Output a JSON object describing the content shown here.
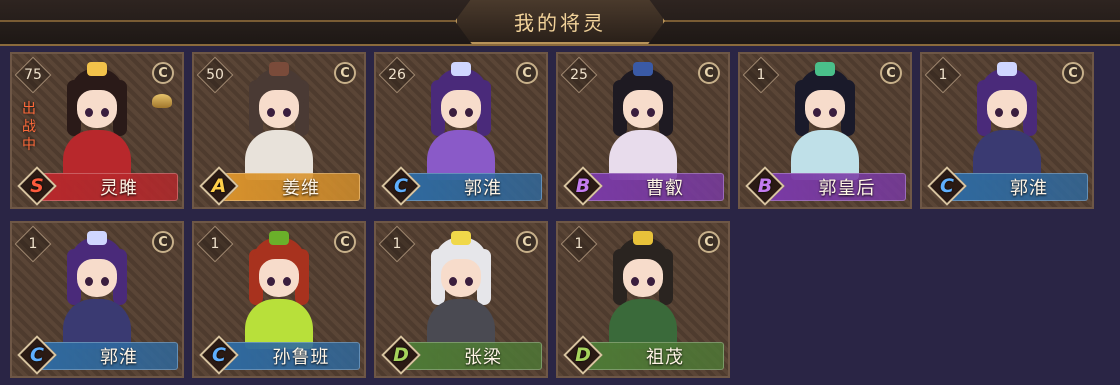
{
  "header": {
    "title": "我的将灵"
  },
  "coin_glyph": "C",
  "status_colors": {
    "active": "#ff6a3a"
  },
  "grade_colors": {
    "S": {
      "bar": "#b8282c",
      "letter": "#ff5a3c"
    },
    "A": {
      "bar": "#d8922c",
      "letter": "#ffcf4a"
    },
    "B": {
      "bar": "#7a3aa6",
      "letter": "#c47cf0"
    },
    "C": {
      "bar": "#2f6aa0",
      "letter": "#5fb0ff"
    },
    "D": {
      "bar": "#4e7a36",
      "letter": "#a6d45c"
    }
  },
  "cards": [
    {
      "level": "75",
      "grade": "S",
      "name": "灵雎",
      "status": "出战中",
      "avatar": "lingju-portrait",
      "hair": "#2a1a18",
      "outfit": "#b8282c",
      "accent": "#f2c24a"
    },
    {
      "level": "50",
      "grade": "A",
      "name": "姜维",
      "avatar": "jiangwei-portrait",
      "hair": "#4a3a34",
      "outfit": "#e8e2da",
      "accent": "#7a4b3a"
    },
    {
      "level": "26",
      "grade": "C",
      "name": "郭淮",
      "avatar": "guohuai-portrait",
      "hair": "#4a2a7a",
      "outfit": "#8a5ac8",
      "accent": "#cfd6ff"
    },
    {
      "level": "25",
      "grade": "B",
      "name": "曹叡",
      "avatar": "caorui-portrait",
      "hair": "#1e1a22",
      "outfit": "#e8dcec",
      "accent": "#3a5aa6"
    },
    {
      "level": "1",
      "grade": "B",
      "name": "郭皇后",
      "avatar": "guohuanghou-portrait",
      "hair": "#1a1a2a",
      "outfit": "#bfe0e8",
      "accent": "#4ac08a"
    },
    {
      "level": "1",
      "grade": "C",
      "name": "郭淮",
      "avatar": "guohuai-portrait",
      "hair": "#4a2a7a",
      "outfit": "#3a3a72",
      "accent": "#cfd6ff"
    },
    {
      "level": "1",
      "grade": "C",
      "name": "郭淮",
      "avatar": "guohuai-portrait",
      "hair": "#4a2a7a",
      "outfit": "#3a3a72",
      "accent": "#cfd6ff"
    },
    {
      "level": "1",
      "grade": "C",
      "name": "孙鲁班",
      "avatar": "sunluban-portrait",
      "hair": "#a8321e",
      "outfit": "#b8e03a",
      "accent": "#6ab02a"
    },
    {
      "level": "1",
      "grade": "D",
      "name": "张梁",
      "avatar": "zhangliang-portrait",
      "hair": "#e6e6ea",
      "outfit": "#4a4a52",
      "accent": "#f0d84a"
    },
    {
      "level": "1",
      "grade": "D",
      "name": "祖茂",
      "avatar": "zumao-portrait",
      "hair": "#2a2420",
      "outfit": "#3a6a3a",
      "accent": "#e8c23a"
    }
  ]
}
